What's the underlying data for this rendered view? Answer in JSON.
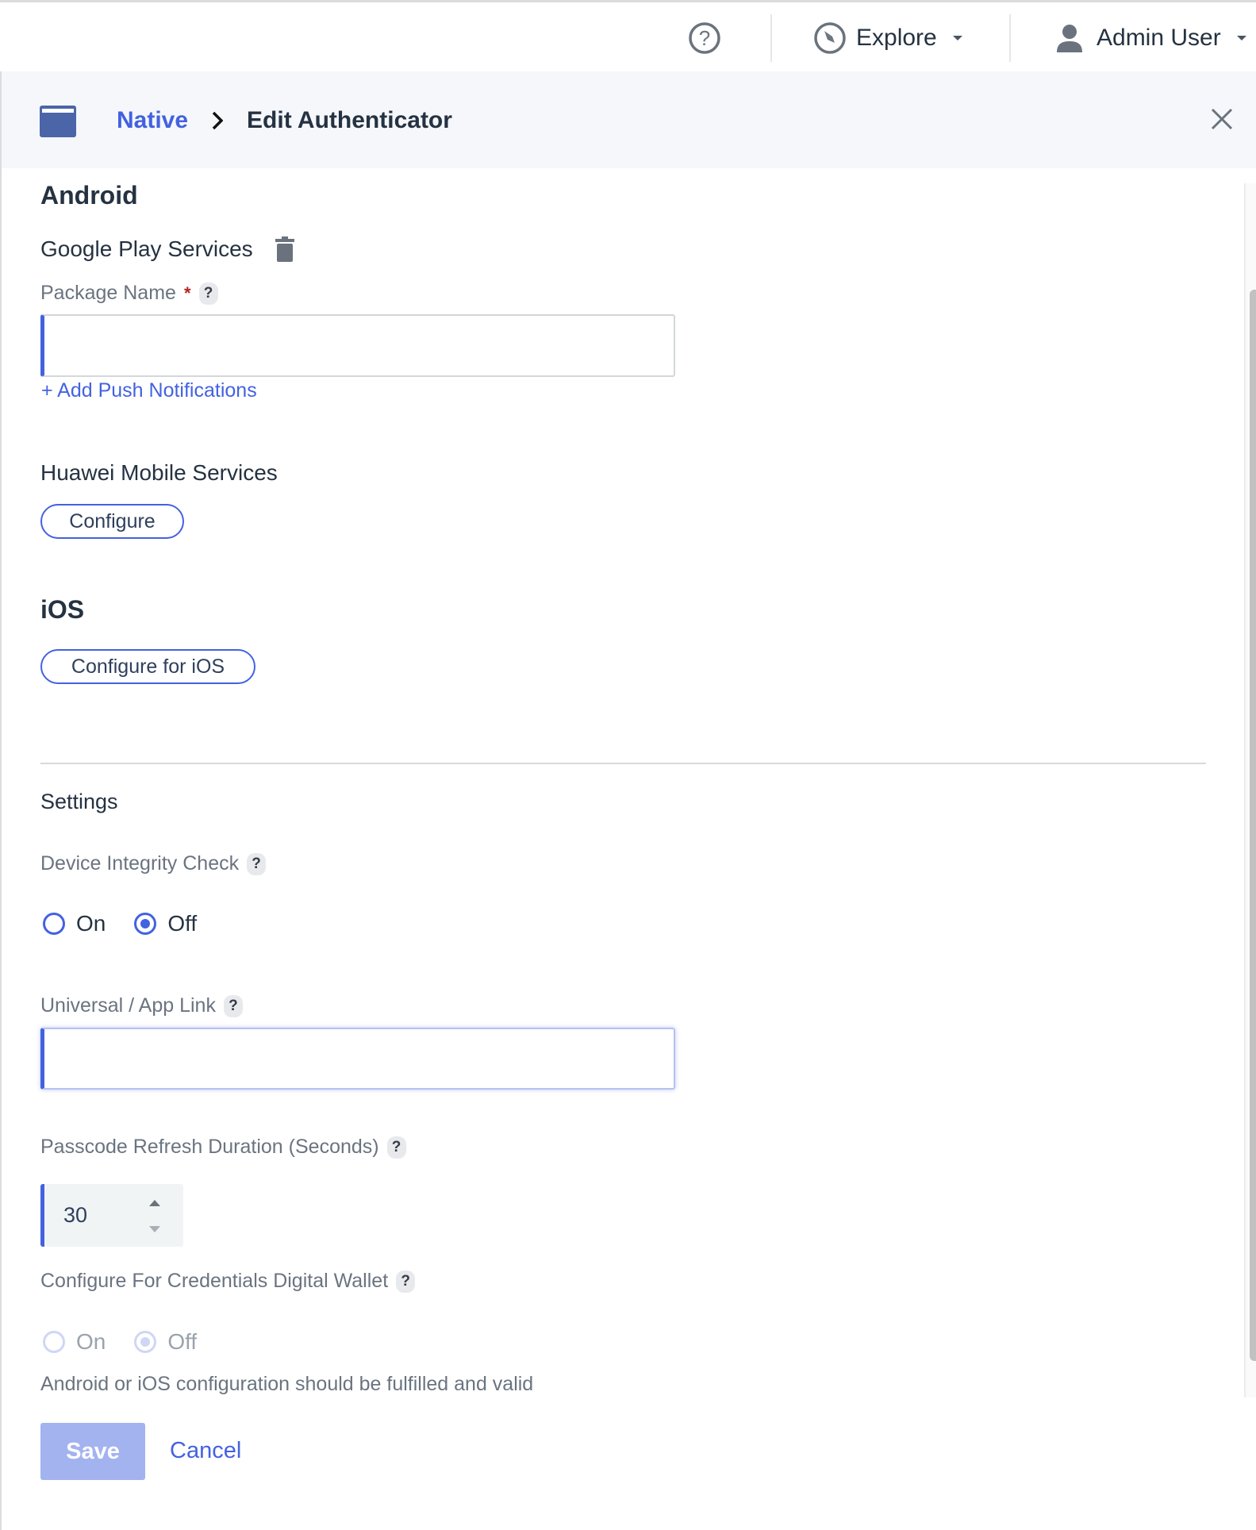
{
  "topbar": {
    "help_icon": "help-circle-icon",
    "explore_label": "Explore",
    "user_label": "Admin User"
  },
  "header": {
    "breadcrumb_parent": "Native",
    "breadcrumb_current": "Edit Authenticator"
  },
  "android": {
    "title": "Android",
    "google_play": {
      "title": "Google Play Services",
      "package_name_label": "Package Name",
      "required_mark": "*",
      "package_name_value": "",
      "add_push_link": "+ Add Push Notifications"
    },
    "huawei": {
      "title": "Huawei Mobile Services",
      "configure_button": "Configure"
    }
  },
  "ios": {
    "title": "iOS",
    "configure_button": "Configure for iOS"
  },
  "settings": {
    "title": "Settings",
    "device_integrity": {
      "label": "Device Integrity Check",
      "options": [
        "On",
        "Off"
      ],
      "selected": "Off"
    },
    "universal_link": {
      "label": "Universal / App Link",
      "value": ""
    },
    "passcode_refresh": {
      "label": "Passcode Refresh Duration (Seconds)",
      "value": "30"
    },
    "digital_wallet": {
      "label": "Configure For Credentials Digital Wallet",
      "options": [
        "On",
        "Off"
      ],
      "selected": "Off",
      "disabled": true,
      "helper_text": "Android or iOS configuration should be fulfilled and valid"
    },
    "help_mark": "?"
  },
  "footer": {
    "save_label": "Save",
    "cancel_label": "Cancel"
  },
  "colors": {
    "accent": "#4362e0",
    "save_disabled": "#a3b3ef",
    "header_bg": "#f5f7fb",
    "text": "#253241"
  }
}
